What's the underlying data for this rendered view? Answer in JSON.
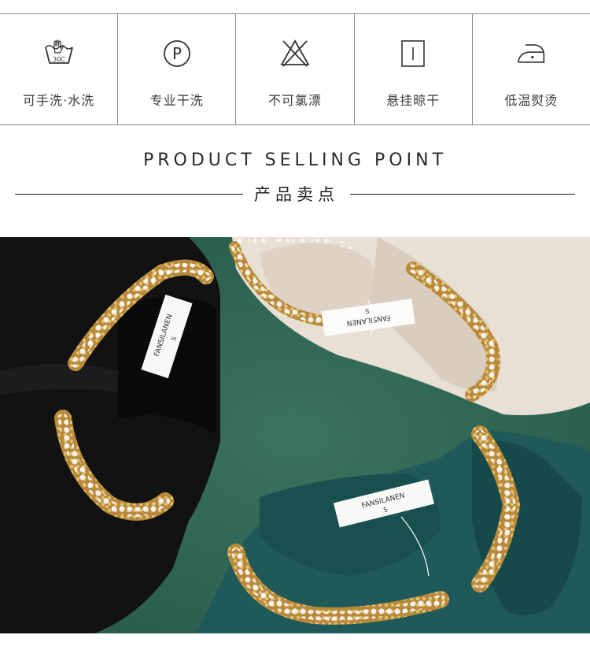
{
  "care_instructions": [
    {
      "icon": "hand-wash-30c-icon",
      "label": "可手洗·水洗",
      "temp": "30C"
    },
    {
      "icon": "professional-dry-clean-icon",
      "label": "专业干洗",
      "symbol": "P"
    },
    {
      "icon": "no-bleach-icon",
      "label": "不可氯漂"
    },
    {
      "icon": "hang-dry-icon",
      "label": "悬挂晾干"
    },
    {
      "icon": "low-iron-icon",
      "label": "低温熨烫"
    }
  ],
  "section": {
    "title_en": "PRODUCT SELLING POINT",
    "title_cn": "产品卖点"
  },
  "photo": {
    "labels": [
      {
        "brand": "FANSILANEN",
        "size": "S"
      },
      {
        "brand": "FANSILANEN",
        "size": "S"
      },
      {
        "brand": "FANSILANEN",
        "size": "S"
      }
    ],
    "colors": {
      "background": "#2f6552",
      "black": "#0f0f0f",
      "cream": "#e9e0d5",
      "teal": "#1f5a5a",
      "pearl": "#f2ede4",
      "gold": "#c9a04a"
    }
  }
}
